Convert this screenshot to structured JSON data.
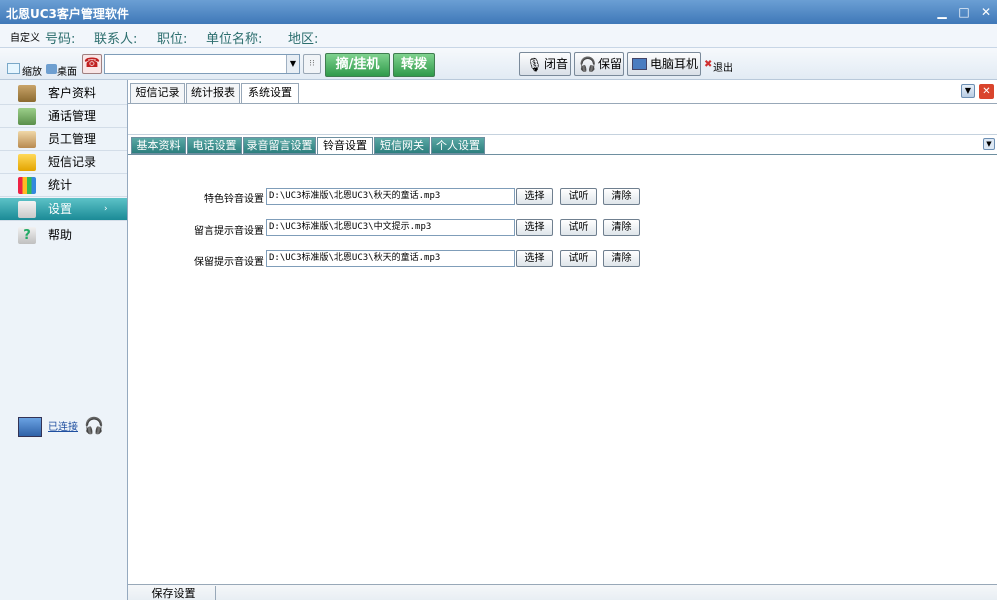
{
  "window": {
    "title": "北恩UC3客户管理软件",
    "minimize": "▁",
    "maximize": "□",
    "close": "✕"
  },
  "info_bar": {
    "custom": "自定义",
    "number": "号码:",
    "contact": "联系人:",
    "position": "职位:",
    "company": "单位名称:",
    "region": "地区:"
  },
  "toolbar": {
    "zoom_label": "缩放",
    "desktop_label": "桌面",
    "dial_value": "",
    "pickup_hangup": "摘/挂机",
    "transfer": "转拨",
    "mute": "闭音",
    "hold": "保留",
    "pc_headset": "电脑耳机",
    "exit": "退出"
  },
  "sidebar": {
    "items": [
      {
        "label": "客户资料",
        "icon": "customer-icon"
      },
      {
        "label": "通话管理",
        "icon": "call-icon"
      },
      {
        "label": "员工管理",
        "icon": "staff-icon"
      },
      {
        "label": "短信记录",
        "icon": "sms-icon"
      },
      {
        "label": "统计",
        "icon": "chart-icon"
      },
      {
        "label": "设置",
        "icon": "settings-icon",
        "active": true
      },
      {
        "label": "帮助",
        "icon": "help-icon"
      }
    ],
    "connection_status": "已连接"
  },
  "main": {
    "top_tabs": [
      "短信记录",
      "统计报表",
      "系统设置"
    ],
    "active_top_tab": "系统设置",
    "settings_tabs": [
      "基本资料",
      "电话设置",
      "录音留言设置",
      "铃音设置",
      "短信网关",
      "个人设置"
    ],
    "active_settings_tab": "铃音设置",
    "rows": [
      {
        "label": "特色铃音设置",
        "path": "D:\\UC3标准版\\北恩UC3\\秋天的童话.mp3"
      },
      {
        "label": "留言提示音设置",
        "path": "D:\\UC3标准版\\北恩UC3\\中文提示.mp3"
      },
      {
        "label": "保留提示音设置",
        "path": "D:\\UC3标准版\\北恩UC3\\秋天的童话.mp3"
      }
    ],
    "row_buttons": {
      "select": "选择",
      "listen": "试听",
      "clear": "清除"
    },
    "save_button": "保存设置"
  },
  "colors": {
    "accent_teal": "#2c7f7e",
    "title_blue": "#3f78b8",
    "close_red": "#d9442c",
    "active_nav": "#1b8a96"
  }
}
